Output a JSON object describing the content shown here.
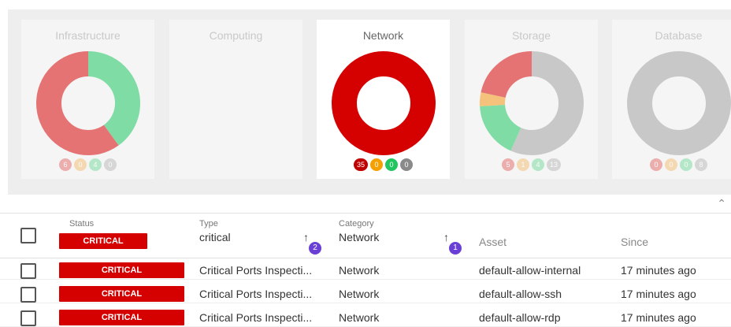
{
  "colors": {
    "critical": "#d50000",
    "high": "#e57373",
    "medium": "#f4c27a",
    "ok": "#7fdca4",
    "none": "#bdbdbd",
    "sort_badge": "#6a3fd6"
  },
  "categories": [
    {
      "title": "Infrastructure",
      "active": false,
      "counts": [
        "6",
        "0",
        "4",
        "0"
      ],
      "slices": [
        6,
        0,
        4,
        0
      ]
    },
    {
      "title": "Computing",
      "active": false,
      "counts": [],
      "slices": []
    },
    {
      "title": "Network",
      "active": true,
      "counts": [
        "35",
        "0",
        "0",
        "0"
      ],
      "slices": [
        35,
        0,
        0,
        0
      ]
    },
    {
      "title": "Storage",
      "active": false,
      "counts": [
        "5",
        "1",
        "4",
        "13"
      ],
      "slices": [
        5,
        1,
        4,
        13
      ]
    },
    {
      "title": "Database",
      "active": false,
      "counts": [
        "0",
        "0",
        "0",
        "8"
      ],
      "slices": [
        0,
        0,
        0,
        8
      ]
    }
  ],
  "table": {
    "headers": {
      "status": "Status",
      "status_filter": "CRITICAL",
      "type": "Type",
      "type_filter": "critical",
      "type_sort_order": "2",
      "category": "Category",
      "category_filter": "Network",
      "category_sort_order": "1",
      "asset": "Asset",
      "since": "Since"
    },
    "rows": [
      {
        "status": "CRITICAL",
        "type": "Critical Ports Inspecti...",
        "category": "Network",
        "asset": "default-allow-internal",
        "since": "17 minutes ago"
      },
      {
        "status": "CRITICAL",
        "type": "Critical Ports Inspecti...",
        "category": "Network",
        "asset": "default-allow-ssh",
        "since": "17 minutes ago"
      },
      {
        "status": "CRITICAL",
        "type": "Critical Ports Inspecti...",
        "category": "Network",
        "asset": "default-allow-rdp",
        "since": "17 minutes ago"
      }
    ]
  },
  "icons": {
    "collapse": "chevron-up-icon",
    "sort": "arrow-up-icon"
  }
}
